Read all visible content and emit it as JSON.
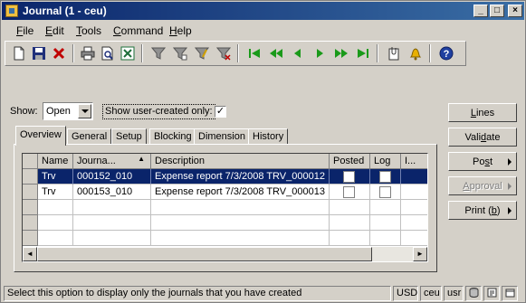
{
  "window": {
    "title": "Journal (1 - ceu)",
    "controls": {
      "minimize": "_",
      "maximize": "□",
      "close": "×"
    }
  },
  "menu": {
    "items": [
      {
        "label": "File",
        "key": "F",
        "rest": "ile"
      },
      {
        "label": "Edit",
        "key": "E",
        "rest": "dit"
      },
      {
        "label": "Tools",
        "key": "T",
        "rest": "ools"
      },
      {
        "label": "Command",
        "key": "C",
        "rest": "ommand"
      },
      {
        "label": "Help",
        "key": "H",
        "rest": "elp"
      }
    ]
  },
  "toolbar": {
    "icons": [
      "new-icon",
      "save-icon",
      "delete-icon",
      "print-icon",
      "print-preview-icon",
      "export-excel-icon",
      "filter-icon",
      "filter-by-field-icon",
      "advanced-filter-icon",
      "clear-filter-icon",
      "first-record-icon",
      "previous-page-icon",
      "previous-record-icon",
      "next-record-icon",
      "next-page-icon",
      "last-record-icon",
      "attach-document-icon",
      "alert-bell-icon",
      "help-icon"
    ]
  },
  "show": {
    "label": "Show:",
    "value": "Open",
    "user_created_label": "Show user-created only:",
    "user_created_checked": true,
    "check_mark": "✓"
  },
  "tabs": [
    {
      "label": "Overview",
      "active": true
    },
    {
      "label": "General",
      "active": false
    },
    {
      "label": "Setup",
      "active": false
    },
    {
      "label": "Blocking",
      "active": false
    },
    {
      "label": "Dimension",
      "active": false
    },
    {
      "label": "History",
      "active": false
    }
  ],
  "grid": {
    "columns": [
      "Name",
      "Journa...",
      "Description",
      "Posted",
      "Log",
      "I..."
    ],
    "sort_indicator": "▲",
    "rows": [
      {
        "name": "Trv",
        "journal": "000152_010",
        "description": "Expense report 7/3/2008 TRV_000012",
        "posted": false,
        "log": false,
        "selected": true
      },
      {
        "name": "Trv",
        "journal": "000153_010",
        "description": "Expense report 7/3/2008 TRV_000013",
        "posted": false,
        "log": false,
        "selected": false
      }
    ],
    "scroll_left": "◄",
    "scroll_right": "►"
  },
  "side_buttons": [
    {
      "label": "Lines",
      "key": "L",
      "rest": "ines",
      "enabled": true,
      "menu": false
    },
    {
      "label": "Validate",
      "pre": "Vali",
      "key": "d",
      "rest": "ate",
      "enabled": true,
      "menu": false
    },
    {
      "label": "Post",
      "pre": "Po",
      "key": "s",
      "rest": "t",
      "enabled": true,
      "menu": true
    },
    {
      "label": "Approval",
      "key": "A",
      "rest": "pproval",
      "enabled": false,
      "menu": true
    },
    {
      "label": "Print (b)",
      "pre": "Print (",
      "key": "b",
      "rest": ")",
      "enabled": true,
      "menu": true
    }
  ],
  "status": {
    "message": "Select this option to display only the journals that you have created",
    "currency": "USD",
    "company": "ceu",
    "layer": "usr"
  }
}
